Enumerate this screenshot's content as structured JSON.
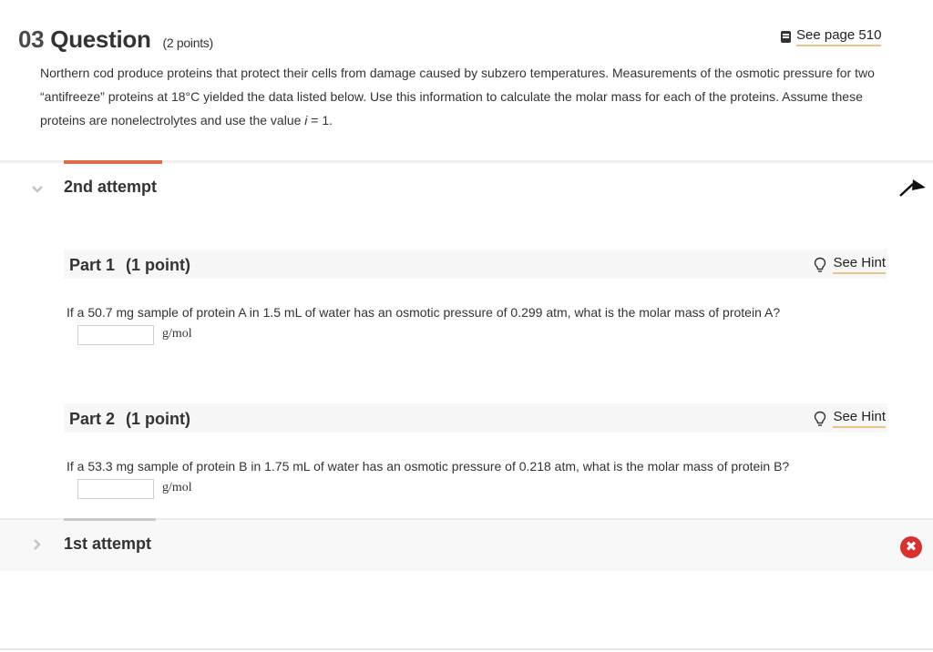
{
  "question": {
    "number": "03",
    "title": "Question",
    "points": "(2 points)",
    "see_page": "See page 510",
    "text_before_i": "Northern cod produce proteins that protect their cells from damage caused by subzero temperatures. Measurements of the osmotic pressure for two “antifreeze” proteins at 18°C yielded the data listed below. Use this information to calculate the molar mass for each of the proteins. Assume these proteins are nonelectrolytes and use the value ",
    "i_var": "i",
    "text_after_i": " = 1."
  },
  "attempts": [
    {
      "label": "2nd attempt",
      "expanded": true,
      "parts": [
        {
          "title": "Part 1",
          "points": "(1 point)",
          "hint": "See Hint",
          "prompt": "If a 50.7  mg sample of protein A in 1.5 mL of water has an osmotic pressure of 0.299  atm, what is the molar mass of protein A?",
          "answer_value": "",
          "unit": "g/mol"
        },
        {
          "title": "Part 2",
          "points": "(1 point)",
          "hint": "See Hint",
          "prompt": "If a 53.3  mg sample of protein B in 1.75 mL of water has an osmotic pressure of 0.218 atm, what is the molar mass of protein B?",
          "answer_value": "",
          "unit": "g/mol"
        }
      ]
    },
    {
      "label": "1st attempt",
      "expanded": false,
      "status": "incorrect"
    }
  ],
  "colors": {
    "accent": "#e06c4a",
    "hint_underline": "#e8c48a",
    "error": "#d9302f"
  },
  "icons": {
    "see_page": "book-icon",
    "hint": "lightbulb-icon",
    "collapse": "arrow-up-icon",
    "status": "x-circle-icon",
    "expanded_chevron": "chevron-down-icon",
    "collapsed_chevron": "chevron-right-icon"
  }
}
